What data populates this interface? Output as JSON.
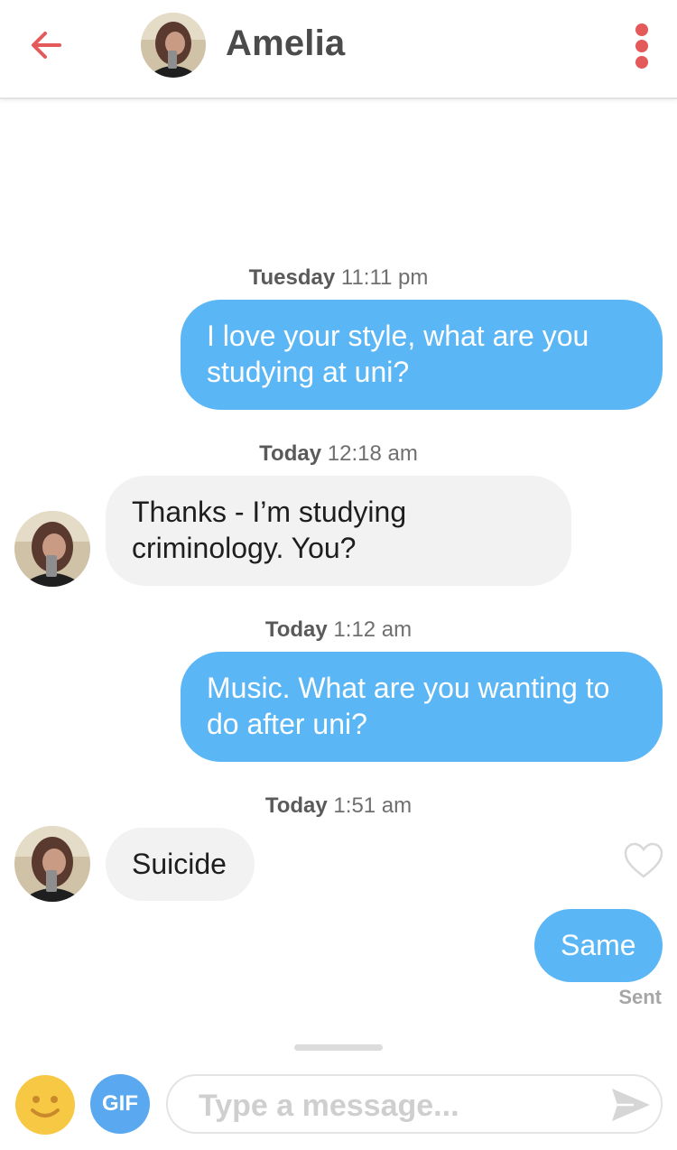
{
  "header": {
    "contact_name": "Amelia",
    "back_icon": "arrow-left-icon",
    "menu_icon": "more-vertical-icon",
    "accent_color": "#e4595a"
  },
  "messages": [
    {
      "type": "timestamp",
      "day": "Tuesday",
      "time": "11:11 pm"
    },
    {
      "type": "outgoing",
      "text_line1": "I love your style, what are you",
      "text_line2": "studying at uni?"
    },
    {
      "type": "timestamp",
      "day": "Today",
      "time": "12:18 am"
    },
    {
      "type": "incoming",
      "text_line1": "Thanks - I’m studying",
      "text_line2": "criminology. You?"
    },
    {
      "type": "timestamp",
      "day": "Today",
      "time": "1:12 am"
    },
    {
      "type": "outgoing",
      "text_line1": "Music. What are you wanting to",
      "text_line2": "do after uni?"
    },
    {
      "type": "timestamp",
      "day": "Today",
      "time": "1:51 am"
    },
    {
      "type": "incoming",
      "text_line1": "Suicide"
    },
    {
      "type": "outgoing",
      "text_line1": "Same"
    }
  ],
  "status": {
    "sent_label": "Sent"
  },
  "composer": {
    "emoji_icon": "smiley-icon",
    "gif_label": "GIF",
    "placeholder": "Type a message...",
    "send_icon": "send-icon"
  },
  "colors": {
    "outgoing_bubble": "#5bb6f5",
    "incoming_bubble": "#f2f2f2",
    "gif_button": "#5aa8f0",
    "emoji_face": "#f7c844"
  }
}
